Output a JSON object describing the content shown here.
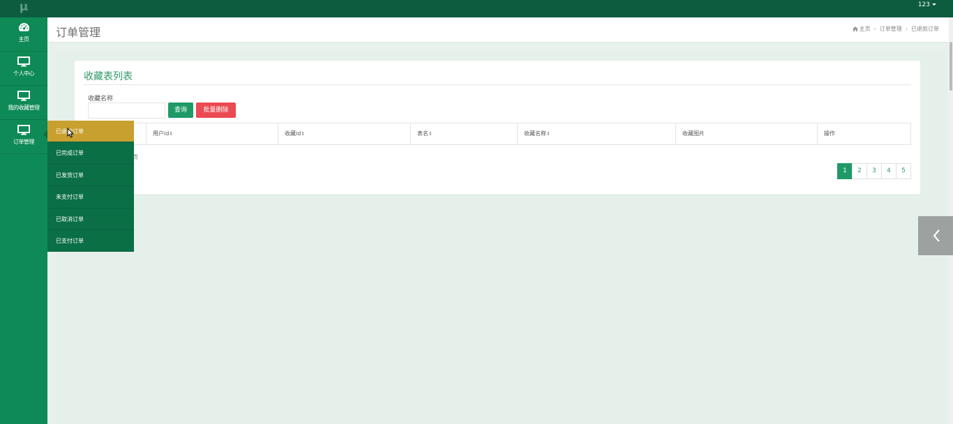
{
  "app": {
    "logo": "μ",
    "user": "123"
  },
  "sidebar": {
    "items": [
      {
        "label": "主页",
        "icon": "dashboard-icon"
      },
      {
        "label": "个人中心",
        "icon": "monitor-icon"
      },
      {
        "label": "我的收藏管理",
        "icon": "monitor-icon"
      },
      {
        "label": "订单管理",
        "icon": "monitor-icon"
      }
    ],
    "submenu": [
      {
        "label": "已退款订单",
        "highlight": true
      },
      {
        "label": "已完成订单",
        "highlight": false
      },
      {
        "label": "已发货订单",
        "highlight": false
      },
      {
        "label": "未支付订单",
        "highlight": false
      },
      {
        "label": "已取消订单",
        "highlight": false
      },
      {
        "label": "已支付订单",
        "highlight": false
      }
    ]
  },
  "header": {
    "title": "订单管理",
    "breadcrumb": [
      "主页",
      "订单管理",
      "已退款订单"
    ]
  },
  "panel": {
    "title": "收藏表列表",
    "search_label": "收藏名称",
    "search_value": "",
    "query_button": "查询",
    "delete_button": "批量删除"
  },
  "table": {
    "columns": [
      "用户id",
      "收藏id",
      "表名",
      "收藏名称",
      "收藏图片",
      "操作"
    ],
    "rows": []
  },
  "pager": {
    "info_fragment": "页",
    "pages": [
      "1",
      "2",
      "3",
      "4",
      "5"
    ],
    "active_page": "1"
  },
  "colors": {
    "topbar": "#0d5c3f",
    "sidebar": "#0e8a56",
    "accent": "#1f9a67",
    "danger": "#eb4a52",
    "highlight": "#c8a02f"
  }
}
